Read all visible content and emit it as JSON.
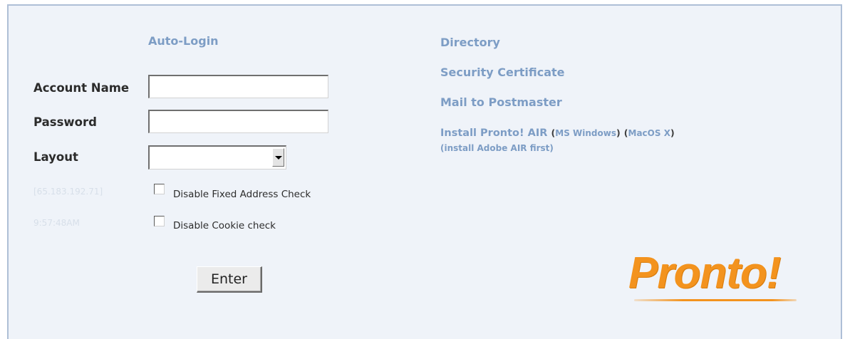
{
  "login": {
    "auto_login": "Auto-Login",
    "account_name_label": "Account Name",
    "account_name_value": "",
    "password_label": "Password",
    "password_value": "",
    "layout_label": "Layout",
    "layout_value": "",
    "ip_address": "[65.183.192.71]",
    "time": "9:57:48AM",
    "disable_fixed_address_label": "Disable Fixed Address Check",
    "disable_cookie_label": "Disable Cookie check",
    "enter_label": "Enter"
  },
  "links": {
    "directory": "Directory",
    "security_certificate": "Security Certificate",
    "mail_to_postmaster": "Mail to Postmaster",
    "install_pronto_air": "Install Pronto! AIR",
    "open_paren": "(",
    "close_paren": ")",
    "ms_windows": "MS Windows",
    "macos_x": "MacOS X",
    "install_adobe_air": "(install Adobe AIR first)"
  },
  "logo": {
    "text": "Pronto!",
    "color": "#f3931e"
  }
}
